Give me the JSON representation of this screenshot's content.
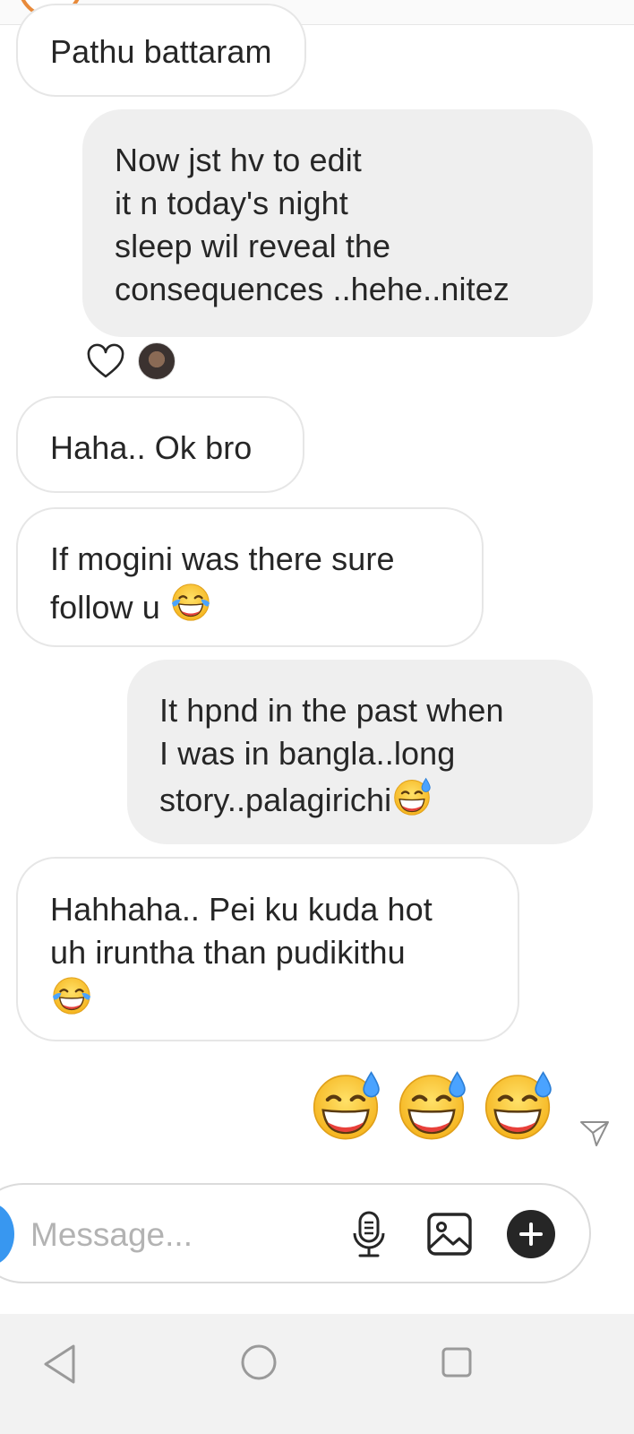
{
  "thread": {
    "messages": [
      {
        "direction": "incoming",
        "lines": [
          "Pathu battaram"
        ]
      },
      {
        "direction": "outgoing",
        "lines": [
          "Now jst hv to edit",
          "it n today's night",
          "sleep wil reveal the",
          "consequences ..hehe..nitez"
        ]
      },
      {
        "direction": "incoming",
        "lines": [
          "Haha.. Ok bro"
        ]
      },
      {
        "direction": "incoming",
        "lines": [
          "If mogini was there sure",
          "follow u"
        ],
        "emoji": "tears-of-joy"
      },
      {
        "direction": "outgoing",
        "lines": [
          "It hpnd in the past when",
          "I was in bangla..long",
          "story..palagirichi"
        ],
        "emoji": "grinning-sweat"
      },
      {
        "direction": "incoming",
        "lines": [
          "Hahhaha.. Pei ku kuda hot",
          "uh iruntha than pudikithu"
        ],
        "emoji": "tears-of-joy"
      }
    ],
    "reaction": {
      "icon": "heart-outline-icon",
      "reactor": "avatar"
    },
    "big_emoji": {
      "name": "grinning-face-with-sweat",
      "count": 3
    }
  },
  "composer": {
    "placeholder": "Message...",
    "icons": [
      "camera-icon",
      "microphone-icon",
      "gallery-icon",
      "plus-icon"
    ]
  },
  "navbar": {
    "icons": [
      "back-icon",
      "home-icon",
      "recent-apps-icon"
    ]
  },
  "colors": {
    "incoming_border": "#e6e6e6",
    "outgoing_bg": "#efefef",
    "accent_blue": "#3897f0",
    "text": "#262626",
    "placeholder": "#b3b3b3"
  }
}
